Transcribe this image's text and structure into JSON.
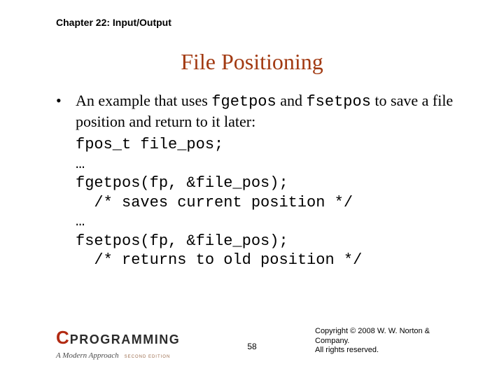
{
  "header": {
    "chapter": "Chapter 22: Input/Output"
  },
  "title": "File Positioning",
  "body": {
    "bullet_pre": "An example that uses ",
    "fn1": "fgetpos",
    "mid1": " and ",
    "fn2": "fsetpos",
    "post": " to save a file position and return to it later:",
    "code": "fpos_t file_pos;\n…\nfgetpos(fp, &file_pos);\n  /* saves current position */\n…\nfsetpos(fp, &file_pos);\n  /* returns to old position */"
  },
  "footer": {
    "logo_c": "C",
    "logo_programming": "PROGRAMMING",
    "logo_sub": "A Modern Approach",
    "logo_edition": "SECOND EDITION",
    "page": "58",
    "copyright_l1": "Copyright © 2008 W. W. Norton & Company.",
    "copyright_l2": "All rights reserved."
  }
}
